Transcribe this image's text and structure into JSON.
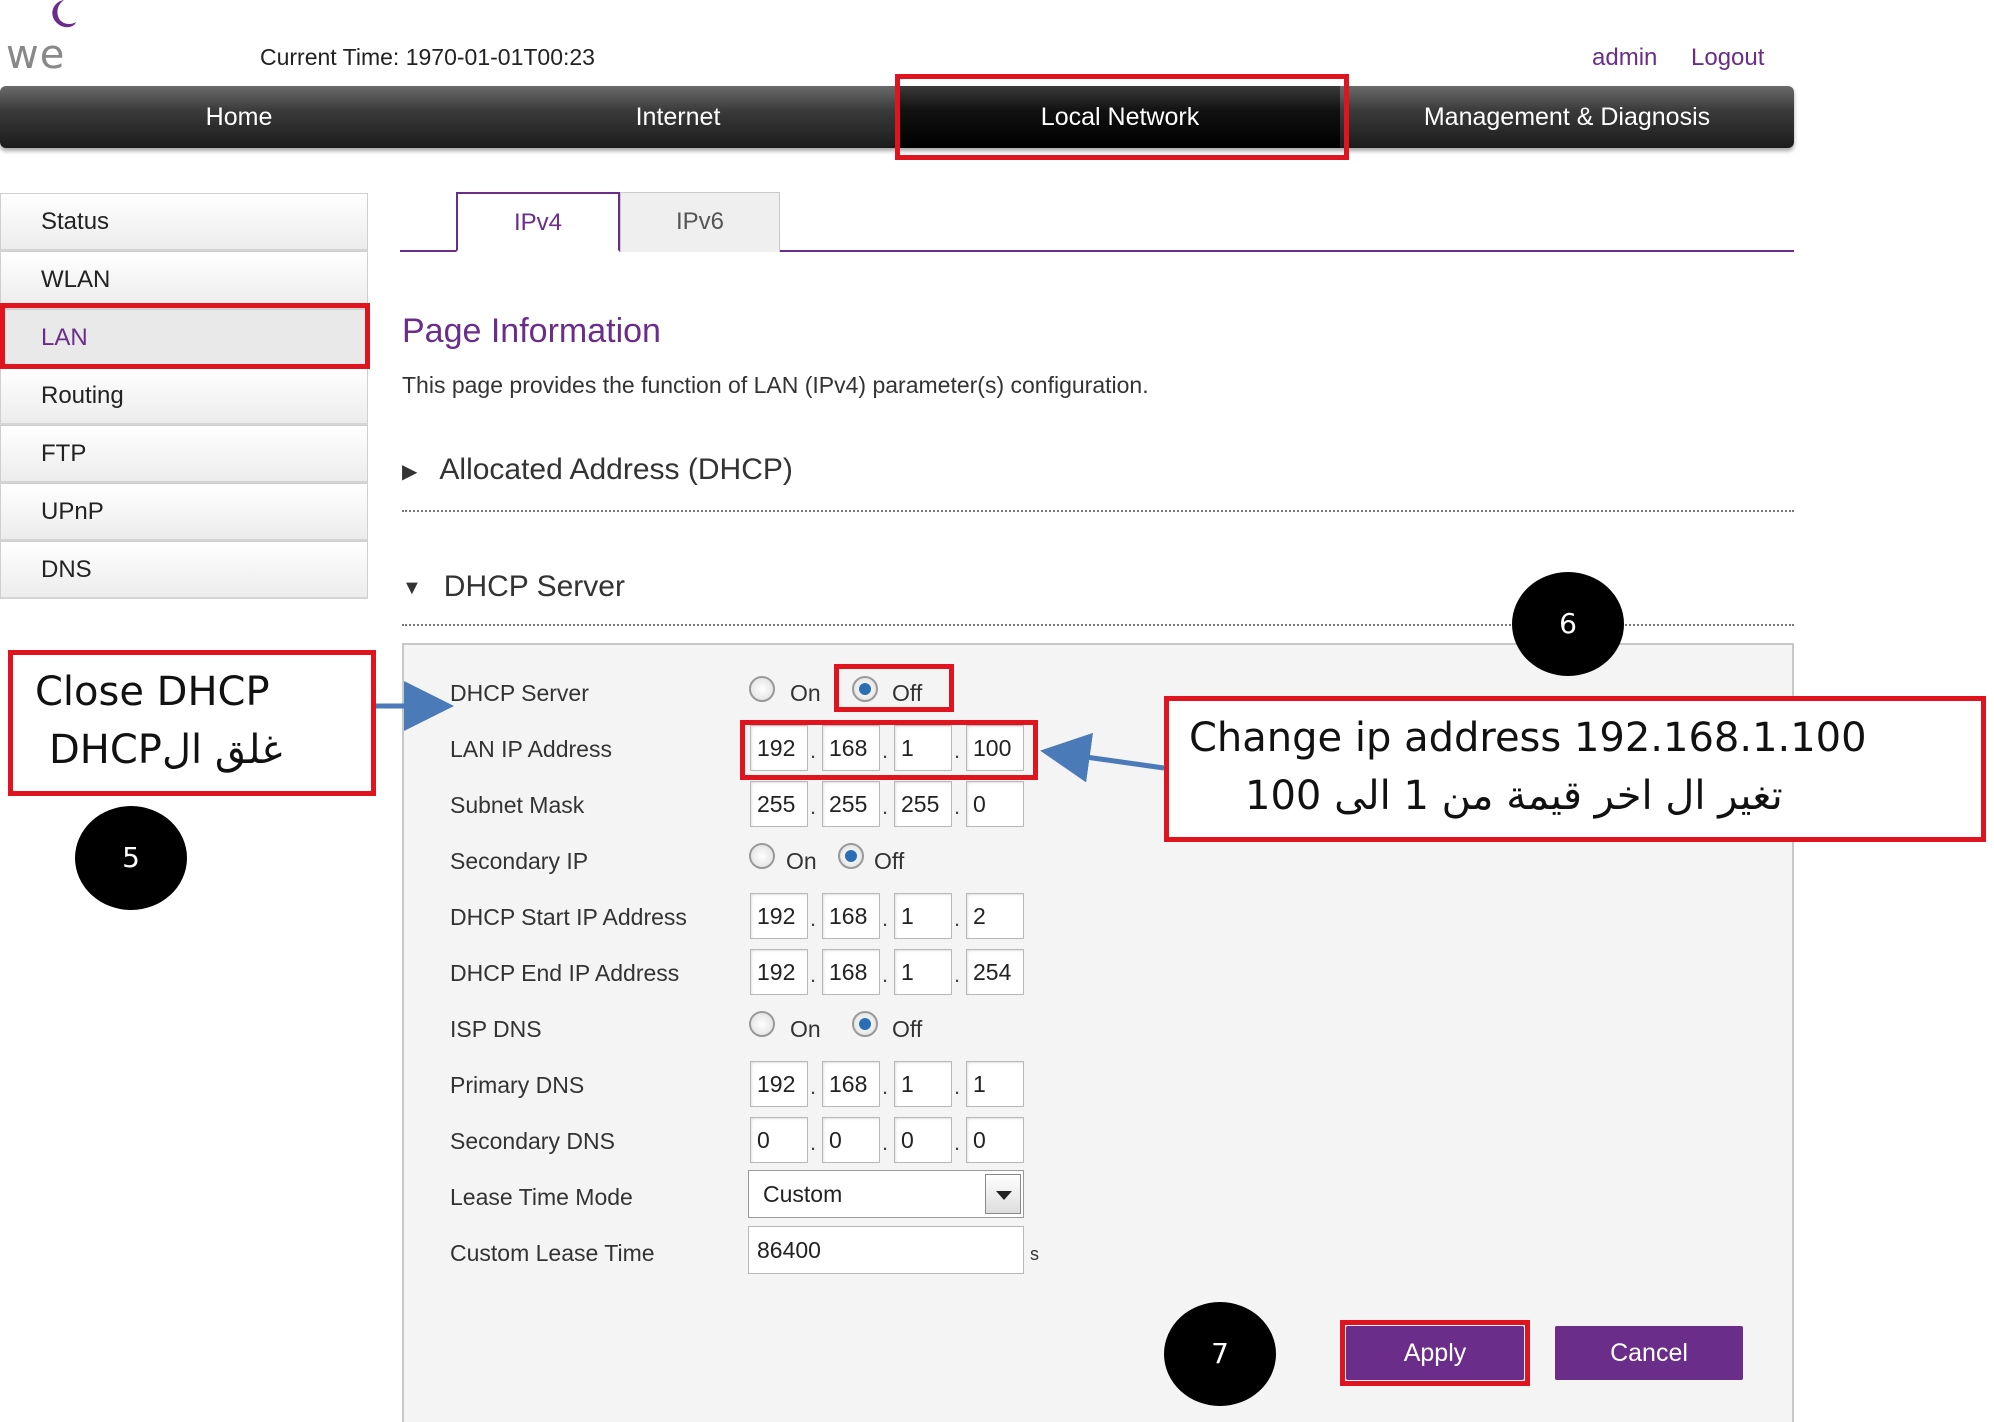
{
  "header": {
    "logo_text": "we",
    "current_time_label": "Current Time: 1970-01-01T00:23",
    "user": "admin",
    "logout": "Logout"
  },
  "nav": {
    "items": [
      "Home",
      "Internet",
      "Local Network",
      "Management & Diagnosis"
    ],
    "active": "Local Network"
  },
  "sidebar": {
    "items": [
      "Status",
      "WLAN",
      "LAN",
      "Routing",
      "FTP",
      "UPnP",
      "DNS"
    ],
    "active": "LAN"
  },
  "tabs": {
    "items": [
      "IPv4",
      "IPv6"
    ],
    "active": "IPv4"
  },
  "page": {
    "title": "Page Information",
    "description": "This page provides the function of LAN (IPv4) parameter(s) configuration."
  },
  "sections": {
    "allocated": "Allocated Address (DHCP)",
    "dhcp_server": "DHCP Server"
  },
  "form": {
    "dhcp_server": {
      "label": "DHCP Server",
      "on": "On",
      "off": "Off",
      "selected": "Off"
    },
    "lan_ip": {
      "label": "LAN IP Address",
      "octets": [
        "192",
        "168",
        "1",
        "100"
      ]
    },
    "subnet_mask": {
      "label": "Subnet Mask",
      "octets": [
        "255",
        "255",
        "255",
        "0"
      ]
    },
    "secondary_ip": {
      "label": "Secondary IP",
      "on": "On",
      "off": "Off",
      "selected": "Off"
    },
    "dhcp_start": {
      "label": "DHCP Start IP Address",
      "octets": [
        "192",
        "168",
        "1",
        "2"
      ]
    },
    "dhcp_end": {
      "label": "DHCP End IP Address",
      "octets": [
        "192",
        "168",
        "1",
        "254"
      ]
    },
    "isp_dns": {
      "label": "ISP DNS",
      "on": "On",
      "off": "Off",
      "selected": "Off"
    },
    "primary_dns": {
      "label": "Primary DNS",
      "octets": [
        "192",
        "168",
        "1",
        "1"
      ]
    },
    "secondary_dns": {
      "label": "Secondary DNS",
      "octets": [
        "0",
        "0",
        "0",
        "0"
      ]
    },
    "lease_mode": {
      "label": "Lease Time Mode",
      "value": "Custom"
    },
    "lease_time": {
      "label": "Custom Lease Time",
      "value": "86400",
      "unit": "s"
    }
  },
  "buttons": {
    "apply": "Apply",
    "cancel": "Cancel"
  },
  "annotations": {
    "close_dhcp_en": "Close DHCP",
    "close_dhcp_ar": "غلق الDHCP",
    "change_ip_en": "Change ip address 192.168.1.100",
    "change_ip_ar": "تغير ال  اخر قيمة من 1 الى 100",
    "step5": "5",
    "step6": "6",
    "step7": "7"
  },
  "colors": {
    "brand": "#6b2d8a",
    "annotation_red": "#e0141e",
    "arrow_blue": "#4a7ab8"
  }
}
